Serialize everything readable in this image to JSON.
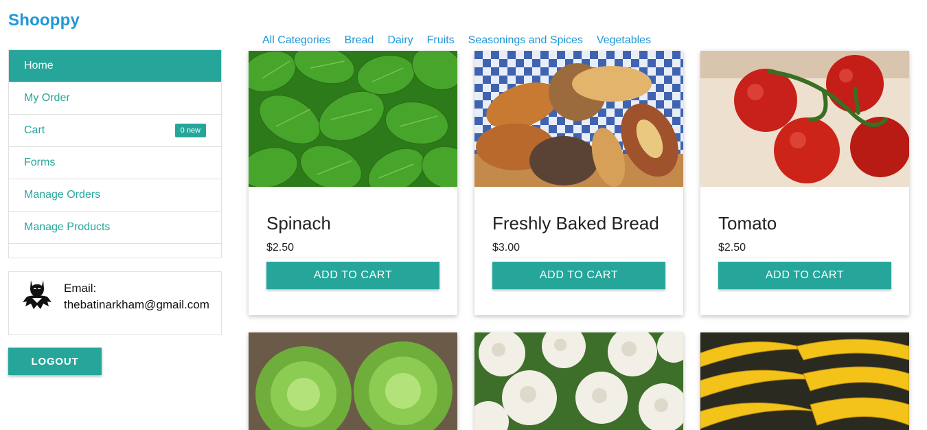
{
  "app": {
    "brand": "Shooppy"
  },
  "sidebar": {
    "items": [
      {
        "label": "Home"
      },
      {
        "label": "My Order"
      },
      {
        "label": "Cart",
        "badge": "0 new"
      },
      {
        "label": "Forms"
      },
      {
        "label": "Manage Orders"
      },
      {
        "label": "Manage Products"
      }
    ]
  },
  "user": {
    "email_label": "Email:",
    "email": "thebatinarkham@gmail.com",
    "avatar_icon": "batman-avatar-icon"
  },
  "logout_label": "LOGOUT",
  "categories": [
    "All Categories",
    "Bread",
    "Dairy",
    "Fruits",
    "Seasonings and Spices",
    "Vegetables"
  ],
  "products": [
    {
      "name": "Spinach",
      "price": "$2.50",
      "button": "ADD TO CART",
      "image": "spinach"
    },
    {
      "name": "Freshly Baked Bread",
      "price": "$3.00",
      "button": "ADD TO CART",
      "image": "bread"
    },
    {
      "name": "Tomato",
      "price": "$2.50",
      "button": "ADD TO CART",
      "image": "tomato"
    },
    {
      "name": "",
      "price": "",
      "button": "",
      "image": "lettuce"
    },
    {
      "name": "",
      "price": "",
      "button": "",
      "image": "cauliflower"
    },
    {
      "name": "",
      "price": "",
      "button": "",
      "image": "banana"
    }
  ],
  "colors": {
    "accent": "#26a69a",
    "brand": "#1f97d8"
  }
}
